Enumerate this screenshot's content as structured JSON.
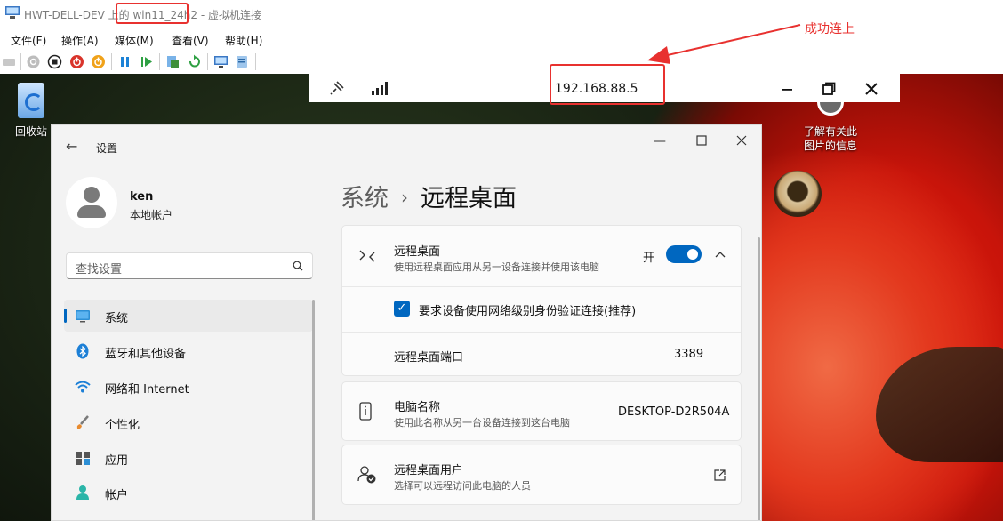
{
  "host_window": {
    "title_prefix": "HWT-DELL-DEV 上的",
    "vm_name": "win11_24h2",
    "title_suffix": "- 虚拟机连接"
  },
  "menu": [
    "文件(F)",
    "操作(A)",
    "媒体(M)",
    "查看(V)",
    "帮助(H)"
  ],
  "toolbar_icons": [
    "ctrl-alt-del-icon",
    "start-icon",
    "turn-off-icon",
    "shutdown-icon",
    "save-icon",
    "pause-icon",
    "resume-icon",
    "checkpoint-icon",
    "revert-icon",
    "enhanced-session-icon",
    "share-icon"
  ],
  "annotation": {
    "text": "成功连上",
    "color": "#e8312f"
  },
  "rdp_bar": {
    "ip": "192.168.88.5"
  },
  "desktop": {
    "recycle_bin_label": "回收站",
    "learn_more_line1": "了解有关此",
    "learn_more_line2": "图片的信息"
  },
  "settings": {
    "app_title": "设置",
    "user": {
      "name": "ken",
      "type": "本地帐户"
    },
    "search_placeholder": "查找设置",
    "nav": [
      {
        "label": "系统",
        "icon": "system-icon",
        "active": true
      },
      {
        "label": "蓝牙和其他设备",
        "icon": "bluetooth-icon"
      },
      {
        "label": "网络和 Internet",
        "icon": "wifi-icon"
      },
      {
        "label": "个性化",
        "icon": "brush-icon"
      },
      {
        "label": "应用",
        "icon": "apps-icon"
      },
      {
        "label": "帐户",
        "icon": "account-icon"
      }
    ],
    "breadcrumb": {
      "parent": "系统",
      "current": "远程桌面"
    },
    "remote_desktop": {
      "title": "远程桌面",
      "subtitle": "使用远程桌面应用从另一设备连接并使用该电脑",
      "toggle_label": "开",
      "nla_label": "要求设备使用网络级别身份验证连接(推荐)",
      "port_label": "远程桌面端口",
      "port_value": "3389"
    },
    "pc_name": {
      "title": "电脑名称",
      "subtitle": "使用此名称从另一台设备连接到这台电脑",
      "value": "DESKTOP-D2R504A"
    },
    "rd_users": {
      "title": "远程桌面用户",
      "subtitle": "选择可以远程访问此电脑的人员"
    }
  },
  "colors": {
    "accent": "#0067c0",
    "annotation_red": "#e8312f"
  }
}
